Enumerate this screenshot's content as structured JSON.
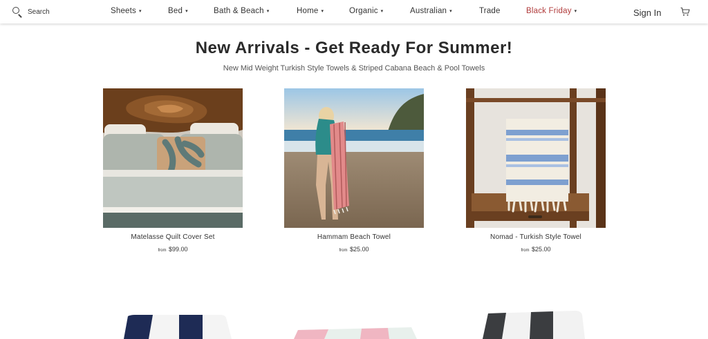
{
  "header": {
    "search_label": "Search",
    "nav": [
      {
        "label": "Sheets",
        "has_dropdown": true
      },
      {
        "label": "Bed",
        "has_dropdown": true
      },
      {
        "label": "Bath & Beach",
        "has_dropdown": true
      },
      {
        "label": "Home",
        "has_dropdown": true
      },
      {
        "label": "Organic",
        "has_dropdown": true
      },
      {
        "label": "Australian",
        "has_dropdown": true
      },
      {
        "label": "Trade",
        "has_dropdown": false
      },
      {
        "label": "Black Friday",
        "has_dropdown": true
      }
    ],
    "caret": "▾",
    "sign_in": "Sign In"
  },
  "main": {
    "title": "New Arrivals - Get Ready For Summer!",
    "subtitle": "New Mid Weight Turkish Style Towels & Striped Cabana Beach & Pool Towels",
    "products": [
      {
        "name": "Matelasse Quilt Cover Set",
        "from": "from",
        "price": "$99.00"
      },
      {
        "name": "Hammam Beach Towel",
        "from": "from",
        "price": "$25.00"
      },
      {
        "name": "Nomad - Turkish Style Towel",
        "from": "from",
        "price": "$25.00"
      }
    ]
  },
  "colors": {
    "sale": "#b03a3a",
    "text": "#333333"
  }
}
